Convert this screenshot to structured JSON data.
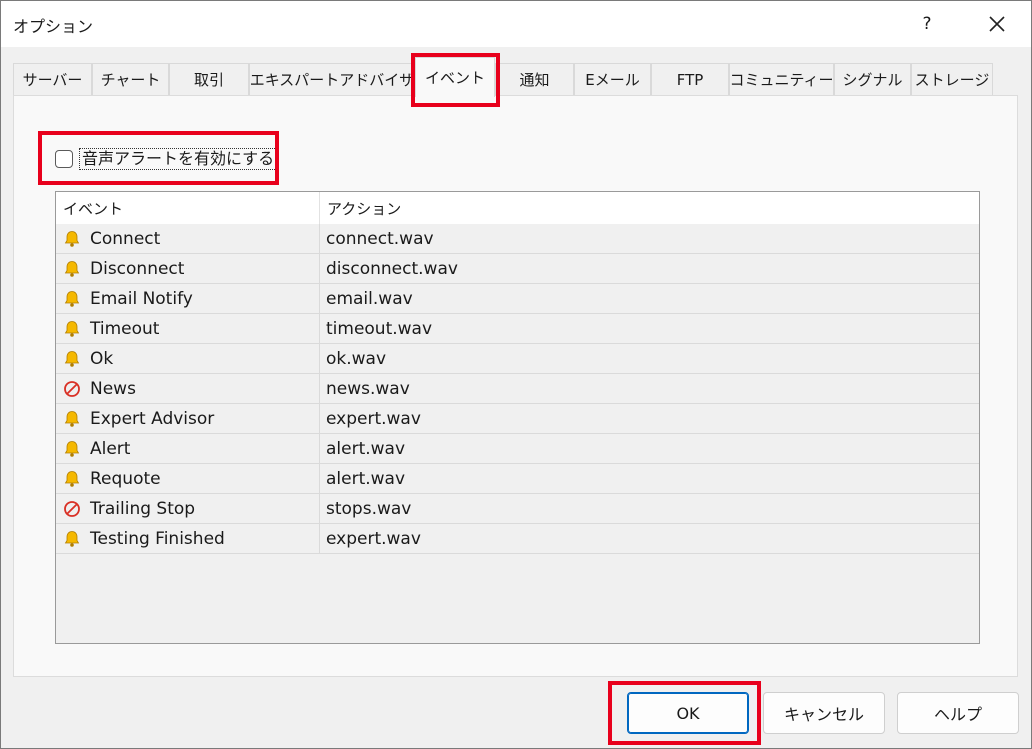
{
  "window": {
    "title": "オプション",
    "help": "?"
  },
  "tabs": [
    {
      "label": "サーバー"
    },
    {
      "label": "チャート"
    },
    {
      "label": "取引"
    },
    {
      "label": "エキスパートアドバイザ"
    },
    {
      "label": "イベント",
      "active": true
    },
    {
      "label": "通知"
    },
    {
      "label": "Eメール"
    },
    {
      "label": "FTP"
    },
    {
      "label": "コミュニティー"
    },
    {
      "label": "シグナル"
    },
    {
      "label": "ストレージ"
    }
  ],
  "sound_alerts": {
    "label": "音声アラートを有効にする",
    "checked": false
  },
  "events_table": {
    "headers": {
      "event": "イベント",
      "action": "アクション"
    },
    "rows": [
      {
        "event": "Connect",
        "action": "connect.wav",
        "icon": "bell-icon"
      },
      {
        "event": "Disconnect",
        "action": "disconnect.wav",
        "icon": "bell-icon"
      },
      {
        "event": "Email Notify",
        "action": "email.wav",
        "icon": "bell-icon"
      },
      {
        "event": "Timeout",
        "action": "timeout.wav",
        "icon": "bell-icon"
      },
      {
        "event": "Ok",
        "action": "ok.wav",
        "icon": "bell-icon"
      },
      {
        "event": "News",
        "action": "news.wav",
        "icon": "disabled-icon"
      },
      {
        "event": "Expert Advisor",
        "action": "expert.wav",
        "icon": "bell-icon"
      },
      {
        "event": "Alert",
        "action": "alert.wav",
        "icon": "bell-icon"
      },
      {
        "event": "Requote",
        "action": "alert.wav",
        "icon": "bell-icon"
      },
      {
        "event": "Trailing Stop",
        "action": "stops.wav",
        "icon": "disabled-icon"
      },
      {
        "event": "Testing Finished",
        "action": "expert.wav",
        "icon": "bell-icon"
      }
    ]
  },
  "buttons": {
    "ok": "OK",
    "cancel": "キャンセル",
    "help": "ヘルプ"
  },
  "colors": {
    "highlight": "#e8001c",
    "bell": "#f5b800",
    "disabled": "#d93025",
    "accent": "#0067c0"
  }
}
